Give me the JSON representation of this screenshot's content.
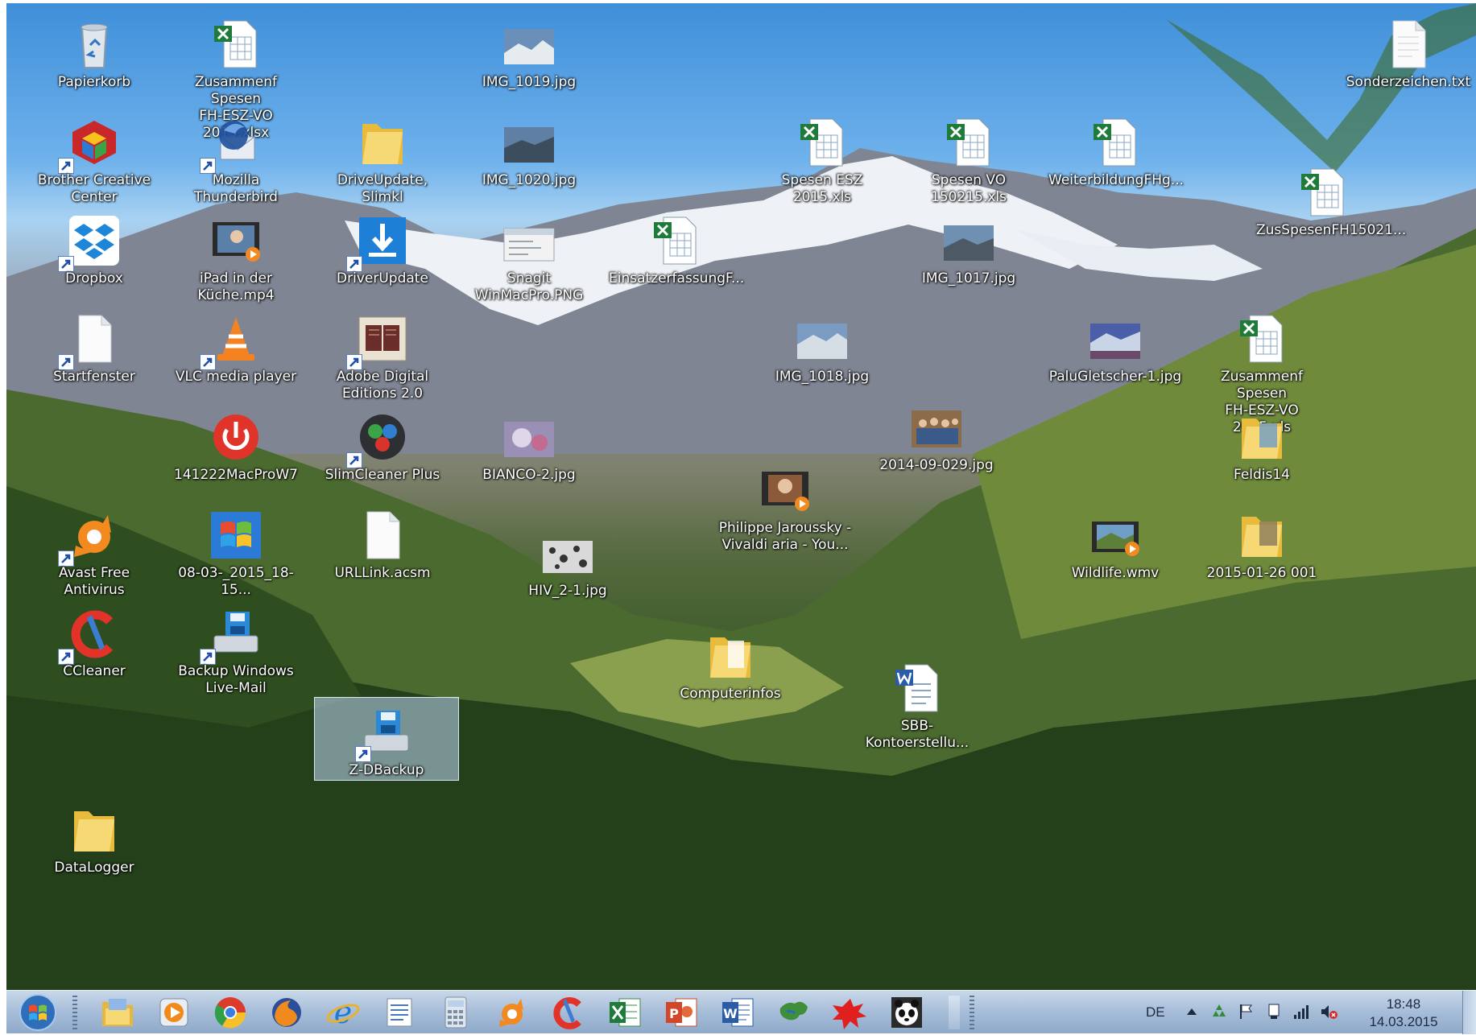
{
  "desktop": {
    "icons": [
      {
        "label": "Papierkorb",
        "icon": "recycle-bin-icon"
      },
      {
        "label": "Zusammenf Spesen\nFH-ESZ-VO 2015.xlsx",
        "icon": "excel-file-icon"
      },
      {
        "label": "IMG_1019.jpg",
        "icon": "image-file-icon"
      },
      {
        "label": "Sonderzeichen.txt",
        "icon": "text-file-icon"
      },
      {
        "label": "Brother Creative\nCenter",
        "icon": "brother-creative-center-icon"
      },
      {
        "label": "Mozilla Thunderbird",
        "icon": "thunderbird-icon"
      },
      {
        "label": "DriveUpdate, Slimkl",
        "icon": "folder-icon"
      },
      {
        "label": "IMG_1020.jpg",
        "icon": "image-file-icon"
      },
      {
        "label": "Spesen ESZ 2015.xls",
        "icon": "excel-file-icon"
      },
      {
        "label": "Spesen VO\n150215.xls",
        "icon": "excel-file-icon"
      },
      {
        "label": "WeiterbildungFHg...",
        "icon": "excel-file-icon"
      },
      {
        "label": "ZusSpesenFH15021...",
        "icon": "excel-file-icon"
      },
      {
        "label": "Dropbox",
        "icon": "dropbox-icon"
      },
      {
        "label": "iPad in der\nKüche.mp4",
        "icon": "video-file-icon"
      },
      {
        "label": "DriverUpdate",
        "icon": "driver-update-icon"
      },
      {
        "label": "Snagit\nWinMacPro.PNG",
        "icon": "png-file-icon"
      },
      {
        "label": "EinsatzerfassungF...",
        "icon": "excel-file-icon"
      },
      {
        "label": "IMG_1017.jpg",
        "icon": "image-file-icon"
      },
      {
        "label": "Startfenster",
        "icon": "blank-file-icon"
      },
      {
        "label": "VLC media player",
        "icon": "vlc-icon"
      },
      {
        "label": "Adobe Digital\nEditions 2.0",
        "icon": "adobe-digital-editions-icon"
      },
      {
        "label": "IMG_1018.jpg",
        "icon": "image-file-icon"
      },
      {
        "label": "PaluGletscher-1.jpg",
        "icon": "image-file-icon"
      },
      {
        "label": "Zusammenf Spesen\nFH-ESZ-VO 2015.xls",
        "icon": "excel-file-icon"
      },
      {
        "label": "141222MacProW7",
        "icon": "power-icon"
      },
      {
        "label": "SlimCleaner Plus",
        "icon": "slimcleaner-icon"
      },
      {
        "label": "BIANCO-2.jpg",
        "icon": "image-file-icon"
      },
      {
        "label": "2014-09-029.jpg",
        "icon": "image-file-icon"
      },
      {
        "label": "Feldis14",
        "icon": "folder-icon"
      },
      {
        "label": "Philippe Jaroussky -\nVivaldi aria - You...",
        "icon": "video-file-icon"
      },
      {
        "label": "Avast Free Antivirus",
        "icon": "avast-icon"
      },
      {
        "label": "08-03-_2015_18-15...",
        "icon": "windows-image-icon"
      },
      {
        "label": "URLLink.acsm",
        "icon": "blank-file-icon"
      },
      {
        "label": "HIV_2-1.jpg",
        "icon": "image-file-icon"
      },
      {
        "label": "Wildlife.wmv",
        "icon": "video-file-icon"
      },
      {
        "label": "2015-01-26 001",
        "icon": "folder-icon"
      },
      {
        "label": "CCleaner",
        "icon": "ccleaner-icon"
      },
      {
        "label": "Backup Windows\nLive-Mail",
        "icon": "backup-icon"
      },
      {
        "label": "Computerinfos",
        "icon": "folder-icon"
      },
      {
        "label": "SBB-Kontoerstellu...",
        "icon": "word-file-icon"
      },
      {
        "label": "Z-DBackup",
        "icon": "backup-icon",
        "selected": true
      },
      {
        "label": "DataLogger",
        "icon": "folder-icon"
      }
    ]
  },
  "taskbar": {
    "pinned": [
      {
        "name": "explorer-icon"
      },
      {
        "name": "media-player-icon"
      },
      {
        "name": "chrome-icon"
      },
      {
        "name": "firefox-icon"
      },
      {
        "name": "internet-explorer-icon"
      },
      {
        "name": "wordpad-icon"
      },
      {
        "name": "calculator-icon"
      },
      {
        "name": "avast-icon"
      },
      {
        "name": "ccleaner-icon"
      },
      {
        "name": "excel-icon"
      },
      {
        "name": "powerpoint-icon"
      },
      {
        "name": "word-icon"
      },
      {
        "name": "map-icon"
      },
      {
        "name": "red-splash-icon"
      },
      {
        "name": "panda-icon"
      }
    ],
    "language": "DE",
    "time": "18:48",
    "date": "14.03.2015"
  },
  "colors": {
    "taskbar": "#a9bfda",
    "excel_green": "#1e7b3a",
    "folder_yellow": "#f2cf5b",
    "selection": "#bed7f5"
  }
}
